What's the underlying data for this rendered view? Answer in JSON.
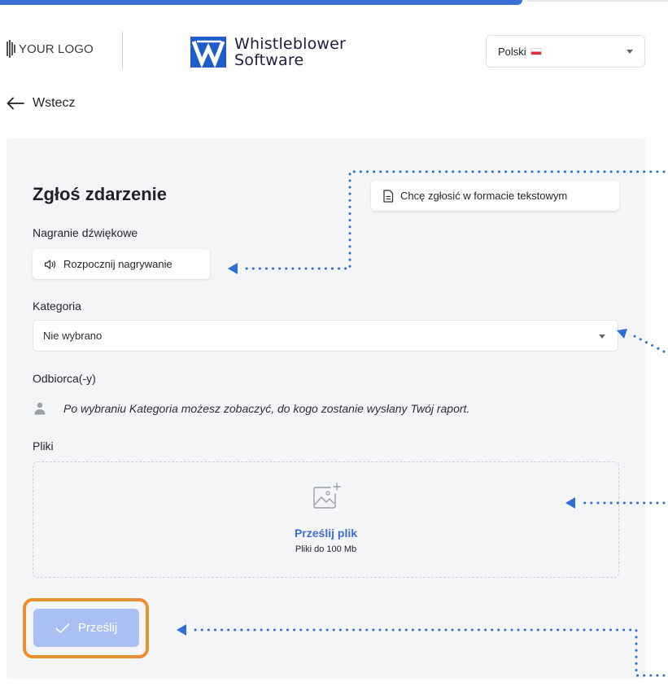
{
  "header": {
    "your_logo_text": "YOUR LOGO",
    "brand_line1": "Whistleblower",
    "brand_line2": "Software",
    "language": "Polski"
  },
  "nav": {
    "back_label": "Wstecz"
  },
  "form": {
    "title": "Zgłoś zdarzenie",
    "text_format_button": "Chcę zgłosić w formacie tekstowym",
    "audio_label": "Nagranie dźwiękowe",
    "record_button": "Rozpocznij nagrywanie",
    "category_label": "Kategoria",
    "category_value": "Nie wybrano",
    "recipients_label": "Odbiorca(-y)",
    "recipients_info": "Po wybraniu Kategoria możesz zobaczyć, do kogo zostanie wysłany Twój raport.",
    "files_label": "Pliki",
    "upload_link": "Prześlij plik",
    "upload_hint": "Pliki do 100 Mb",
    "submit_button": "Prześlij"
  },
  "colors": {
    "accent": "#3b6fd8",
    "submit_disabled": "#a9bff3",
    "highlight": "#e8902f",
    "panel_bg": "#f4f5f7"
  }
}
